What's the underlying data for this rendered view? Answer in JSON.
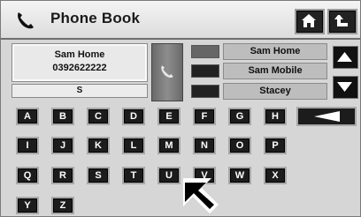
{
  "header": {
    "title": "Phone Book",
    "phone_icon": "phone-handset-icon",
    "home_icon": "home-icon",
    "back_icon": "back-arrow-icon"
  },
  "contact": {
    "name": "Sam Home",
    "number": "0392622222"
  },
  "search": {
    "value": "S"
  },
  "results": [
    "Sam Home",
    "Sam Mobile",
    "Stacey"
  ],
  "keyboard": {
    "rows": [
      [
        "A",
        "B",
        "C",
        "D",
        "E",
        "F",
        "G",
        "H"
      ],
      [
        "I",
        "J",
        "K",
        "L",
        "M",
        "N",
        "O",
        "P"
      ],
      [
        "Q",
        "R",
        "S",
        "T",
        "U",
        "V",
        "W",
        "X"
      ],
      [
        "Y",
        "Z"
      ]
    ],
    "backspace_icon": "backspace-arrow-icon"
  },
  "colors": {
    "key_background": "#1c1c1c",
    "panel_background": "#d6d6d6",
    "result_background": "#bdbdbd"
  }
}
